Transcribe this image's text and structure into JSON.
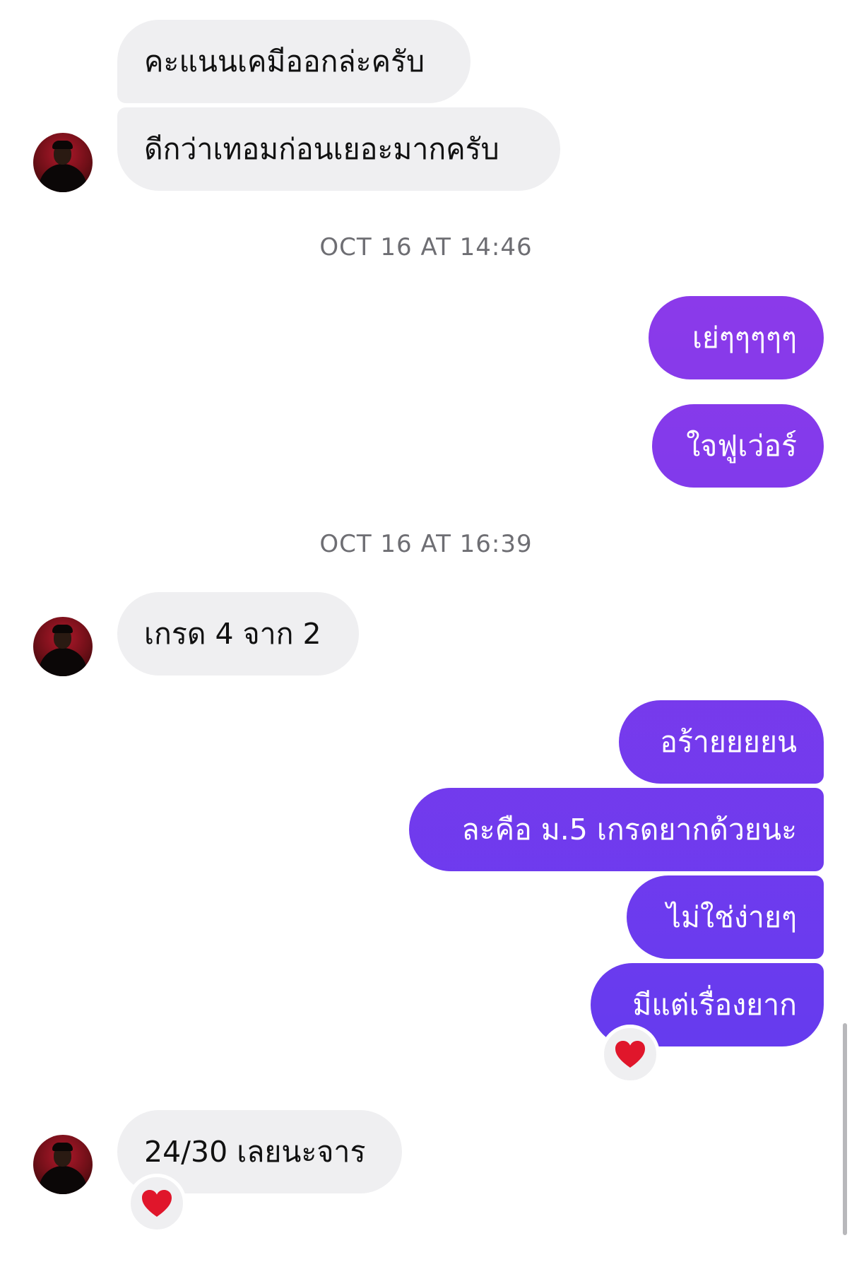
{
  "messages": [
    {
      "text": "คะแนนเคมีออกล่ะครับ",
      "direction": "incoming"
    },
    {
      "text": "ดีกว่าเทอมก่อนเยอะมากครับ",
      "direction": "incoming"
    },
    {
      "text": "เย่ๆๆๆๆๆ",
      "direction": "outgoing"
    },
    {
      "text": "ใจฟูเว่อร์",
      "direction": "outgoing"
    },
    {
      "text": "เกรด 4 จาก 2",
      "direction": "incoming"
    },
    {
      "text": "อร้ายยยยน",
      "direction": "outgoing"
    },
    {
      "text": "ละคือ ม.5 เกรดยากด้วยนะ",
      "direction": "outgoing"
    },
    {
      "text": "ไม่ใช่ง่ายๆ",
      "direction": "outgoing"
    },
    {
      "text": "มีแต่เรื่องยาก",
      "direction": "outgoing",
      "reaction": "heart"
    },
    {
      "text": "24/30 เลยนะจาร",
      "direction": "incoming",
      "reaction": "heart"
    }
  ],
  "timestamps": [
    "OCT 16 AT 14:46",
    "OCT 16 AT 16:39"
  ],
  "colors": {
    "incoming_bubble": "#efeff1",
    "outgoing_gradient_top": "#9a3ae8",
    "outgoing_gradient_bottom": "#5b3bf0",
    "timestamp_text": "#6e6e73",
    "reaction_heart": "#e0162b"
  },
  "icons": {
    "reaction": "heart-icon",
    "avatar": "contact-avatar"
  }
}
